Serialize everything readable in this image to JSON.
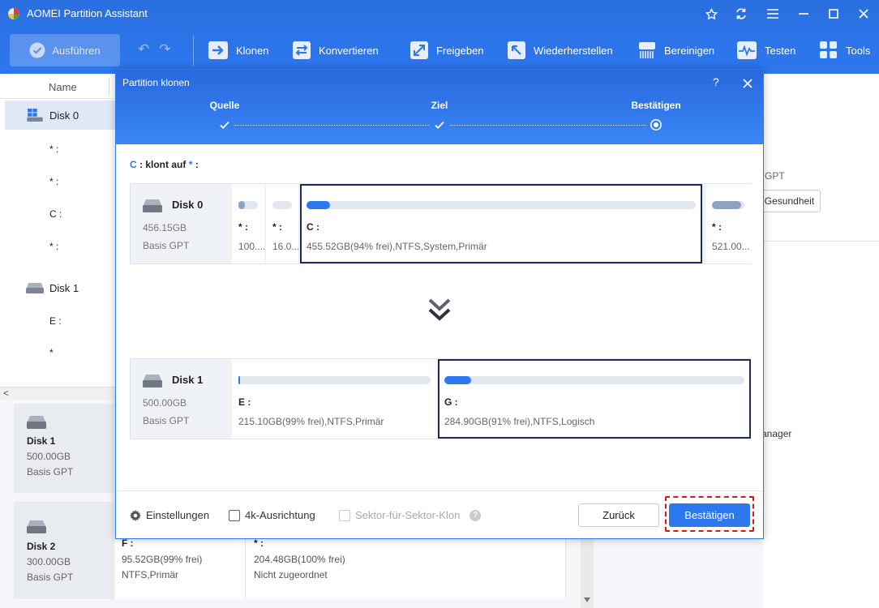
{
  "app": {
    "title": "AOMEI Partition Assistant"
  },
  "toolbar": {
    "run_label": "Ausführen",
    "buttons": [
      {
        "label": "Klonen",
        "icon": "clone-icon"
      },
      {
        "label": "Konvertieren",
        "icon": "convert-icon"
      },
      {
        "label": "Freigeben",
        "icon": "free-up-icon"
      },
      {
        "label": "Wiederherstellen",
        "icon": "recover-icon"
      },
      {
        "label": "Bereinigen",
        "icon": "wipe-icon"
      },
      {
        "label": "Testen",
        "icon": "test-icon"
      },
      {
        "label": "Tools",
        "icon": "tools-icon"
      }
    ]
  },
  "left_panel": {
    "column_name": "Name",
    "disk0_label": "Disk 0",
    "disk1_label": "Disk 1",
    "disk0_parts": [
      "* :",
      "* :",
      "C :",
      "* :"
    ],
    "disk1_parts": [
      "E :",
      "*"
    ]
  },
  "bottom_cards": [
    {
      "name": "Disk 1",
      "size": "500.00GB",
      "type": "Basis GPT"
    },
    {
      "name": "Disk 2",
      "size": "300.00GB",
      "type": "Basis GPT"
    }
  ],
  "bottom_parts": [
    {
      "label": "F :",
      "line1": "95.52GB(99% frei)",
      "line2": "NTFS,Primär"
    },
    {
      "label": "* :",
      "line1": "204.48GB(100% frei)",
      "line2": "Nicht zugeordnet"
    }
  ],
  "right_panel": {
    "gpt": "GPT",
    "health": "Gesundheit",
    "manager": "anager"
  },
  "dialog": {
    "title": "Partition klonen",
    "help": "?",
    "steps": [
      "Quelle",
      "Ziel",
      "Bestätigen"
    ],
    "clone_source": "C",
    "clone_text": ": klont auf",
    "clone_target": "*",
    "clone_suffix": ":",
    "source_disk": {
      "name": "Disk 0",
      "size": "456.15GB",
      "type": "Basis GPT",
      "partitions": [
        {
          "label": "* :",
          "detail": "100....",
          "used": 0.35
        },
        {
          "label": "* :",
          "detail": "16.0...",
          "used": 0
        },
        {
          "label": "C :",
          "detail": "455.52GB(94% frei),NTFS,System,Primär",
          "used": 0.06
        },
        {
          "label": "* :",
          "detail": "521.00...",
          "used": 0.9
        }
      ]
    },
    "target_disk": {
      "name": "Disk 1",
      "size": "500.00GB",
      "type": "Basis GPT",
      "partitions": [
        {
          "label": "E :",
          "detail": "215.10GB(99% frei),NTFS,Primär",
          "used": 0.01
        },
        {
          "label": "G :",
          "detail": "284.90GB(91% frei),NTFS,Logisch",
          "used": 0.09
        }
      ]
    },
    "footer": {
      "settings": "Einstellungen",
      "align_4k": "4k-Ausrichtung",
      "sector_clone": "Sektor-für-Sektor-Klon",
      "back": "Zurück",
      "confirm": "Bestätigen"
    }
  },
  "colors": {
    "accent": "#2d77ef",
    "selected_border": "#1c2b4f",
    "highlight": "#e0101a"
  }
}
